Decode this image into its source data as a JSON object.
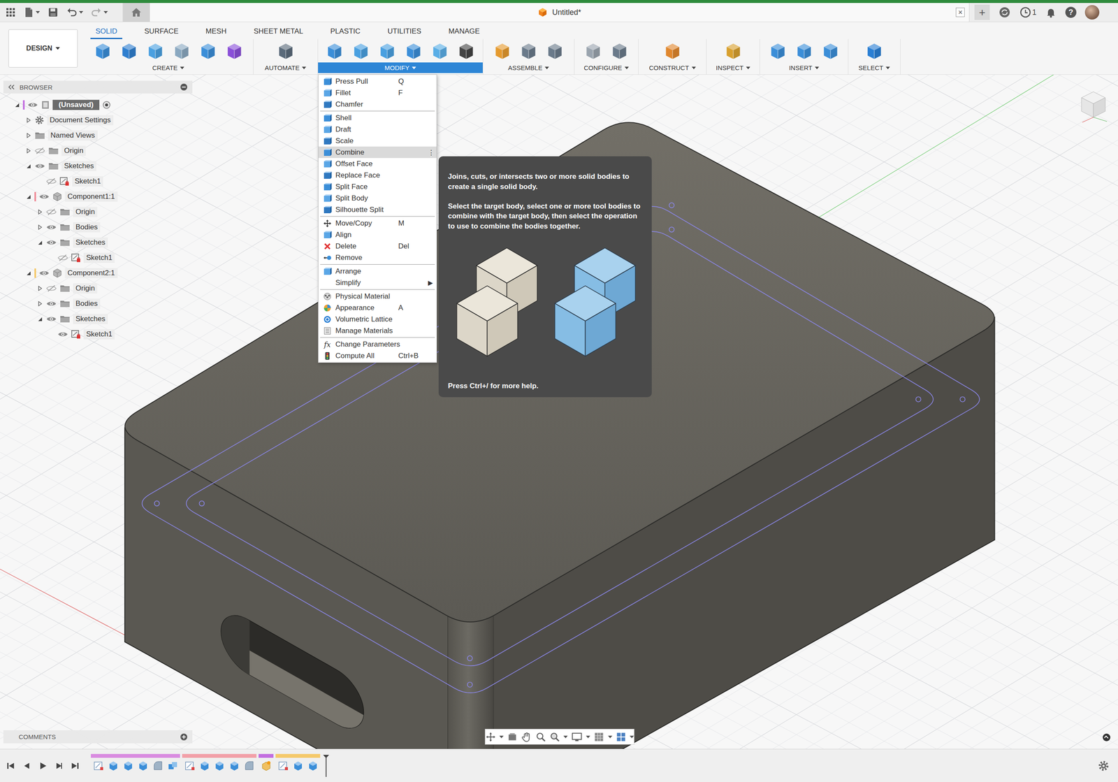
{
  "window": {
    "title": "Untitled*",
    "close": "×",
    "new_tab": "+",
    "jobs": "1",
    "help": "?"
  },
  "workspace": "DESIGN",
  "tabs": [
    {
      "label": "SOLID",
      "selected": true
    },
    {
      "label": "SURFACE",
      "selected": false
    },
    {
      "label": "MESH",
      "selected": false
    },
    {
      "label": "SHEET METAL",
      "selected": false
    },
    {
      "label": "PLASTIC",
      "selected": false
    },
    {
      "label": "UTILITIES",
      "selected": false
    },
    {
      "label": "MANAGE",
      "selected": false
    }
  ],
  "toolbar_groups": [
    {
      "label": "CREATE",
      "selected": false
    },
    {
      "label": "AUTOMATE",
      "selected": false
    },
    {
      "label": "MODIFY",
      "selected": true
    },
    {
      "label": "ASSEMBLE",
      "selected": false
    },
    {
      "label": "CONFIGURE",
      "selected": false
    },
    {
      "label": "CONSTRUCT",
      "selected": false
    },
    {
      "label": "INSPECT",
      "selected": false
    },
    {
      "label": "INSERT",
      "selected": false
    },
    {
      "label": "SELECT",
      "selected": false
    }
  ],
  "browser": {
    "title": "BROWSER",
    "items": [
      {
        "label": "(Unsaved)",
        "kind": "document",
        "depth": 0,
        "expanded": true,
        "visibility": "visible",
        "color": "#c36ee0"
      },
      {
        "label": "Document Settings",
        "kind": "settings",
        "depth": 1,
        "expanded": false,
        "visibility": "none"
      },
      {
        "label": "Named Views",
        "kind": "views",
        "depth": 1,
        "expanded": false,
        "visibility": "none"
      },
      {
        "label": "Origin",
        "kind": "folder",
        "depth": 1,
        "expanded": false,
        "visibility": "hidden"
      },
      {
        "label": "Sketches",
        "kind": "folder",
        "depth": 1,
        "expanded": true,
        "visibility": "visible"
      },
      {
        "label": "Sketch1",
        "kind": "sketch",
        "depth": 2,
        "expanded": false,
        "visibility": "hidden"
      },
      {
        "label": "Component1:1",
        "kind": "component",
        "depth": 1,
        "expanded": true,
        "visibility": "visible",
        "color": "#ef8f9a"
      },
      {
        "label": "Origin",
        "kind": "folder",
        "depth": 2,
        "expanded": false,
        "visibility": "hidden"
      },
      {
        "label": "Bodies",
        "kind": "folder",
        "depth": 2,
        "expanded": false,
        "visibility": "visible"
      },
      {
        "label": "Sketches",
        "kind": "folder",
        "depth": 2,
        "expanded": true,
        "visibility": "visible"
      },
      {
        "label": "Sketch1",
        "kind": "sketch",
        "depth": 3,
        "expanded": false,
        "visibility": "hidden"
      },
      {
        "label": "Component2:1",
        "kind": "component",
        "depth": 1,
        "expanded": true,
        "visibility": "visible",
        "color": "#f5c96b"
      },
      {
        "label": "Origin",
        "kind": "folder",
        "depth": 2,
        "expanded": false,
        "visibility": "hidden"
      },
      {
        "label": "Bodies",
        "kind": "folder",
        "depth": 2,
        "expanded": false,
        "visibility": "visible"
      },
      {
        "label": "Sketches",
        "kind": "folder",
        "depth": 2,
        "expanded": true,
        "visibility": "visible"
      },
      {
        "label": "Sketch1",
        "kind": "sketch",
        "depth": 3,
        "expanded": false,
        "visibility": "visible"
      }
    ]
  },
  "menu": {
    "sections": [
      {
        "items": [
          {
            "label": "Press Pull",
            "shortcut": "Q",
            "selected": false
          },
          {
            "label": "Fillet",
            "shortcut": "F",
            "selected": false
          },
          {
            "label": "Chamfer",
            "selected": false
          }
        ]
      },
      {
        "items": [
          {
            "label": "Shell",
            "selected": false
          },
          {
            "label": "Draft",
            "selected": false
          },
          {
            "label": "Scale",
            "selected": false
          },
          {
            "label": "Combine",
            "selected": true,
            "trailing": "⋮"
          },
          {
            "label": "Offset Face",
            "selected": false
          },
          {
            "label": "Replace Face",
            "selected": false
          },
          {
            "label": "Split Face",
            "selected": false
          },
          {
            "label": "Split Body",
            "selected": false
          },
          {
            "label": "Silhouette Split",
            "selected": false
          }
        ]
      },
      {
        "items": [
          {
            "label": "Move/Copy",
            "shortcut": "M",
            "selected": false
          },
          {
            "label": "Align",
            "selected": false
          },
          {
            "label": "Delete",
            "shortcut": "Del",
            "selected": false
          },
          {
            "label": "Remove",
            "selected": false
          }
        ]
      },
      {
        "items": [
          {
            "label": "Arrange",
            "selected": false
          },
          {
            "label": "Simplify",
            "selected": false,
            "trailing": "▶"
          }
        ]
      },
      {
        "items": [
          {
            "label": "Physical Material",
            "selected": false
          },
          {
            "label": "Appearance",
            "shortcut": "A",
            "selected": false
          },
          {
            "label": "Volumetric Lattice",
            "selected": false
          },
          {
            "label": "Manage Materials",
            "selected": false
          }
        ]
      },
      {
        "items": [
          {
            "label": "Change Parameters",
            "selected": false,
            "glyph": "fx"
          },
          {
            "label": "Compute All",
            "shortcut": "Ctrl+B",
            "selected": false
          }
        ]
      }
    ]
  },
  "tooltip": {
    "paragraphs": [
      "Joins, cuts, or intersects two or more solid bodies to create a single solid body.",
      "Select the target body, select one or more tool bodies to combine with the target body, then select the operation to use to combine the bodies together."
    ],
    "footer": "Press Ctrl+/ for more help."
  },
  "comments": "COMMENTS",
  "timeline": {
    "groups": [
      {
        "color": "#d98be0",
        "features": [
          {
            "kind": "sketch"
          },
          {
            "kind": "extrude"
          },
          {
            "kind": "extrude"
          },
          {
            "kind": "extrude"
          },
          {
            "kind": "fillet"
          },
          {
            "kind": "combine"
          }
        ]
      },
      {
        "color": "#f2a0a8",
        "features": [
          {
            "kind": "sketch"
          },
          {
            "kind": "extrude"
          },
          {
            "kind": "extrude"
          },
          {
            "kind": "extrude"
          },
          {
            "kind": "fillet"
          }
        ]
      },
      {
        "color": "#c36ee0",
        "features": [
          {
            "kind": "component"
          }
        ]
      },
      {
        "color": "#f5c96b",
        "features": [
          {
            "kind": "sketch"
          },
          {
            "kind": "extrude"
          },
          {
            "kind": "extrude"
          }
        ]
      }
    ]
  }
}
